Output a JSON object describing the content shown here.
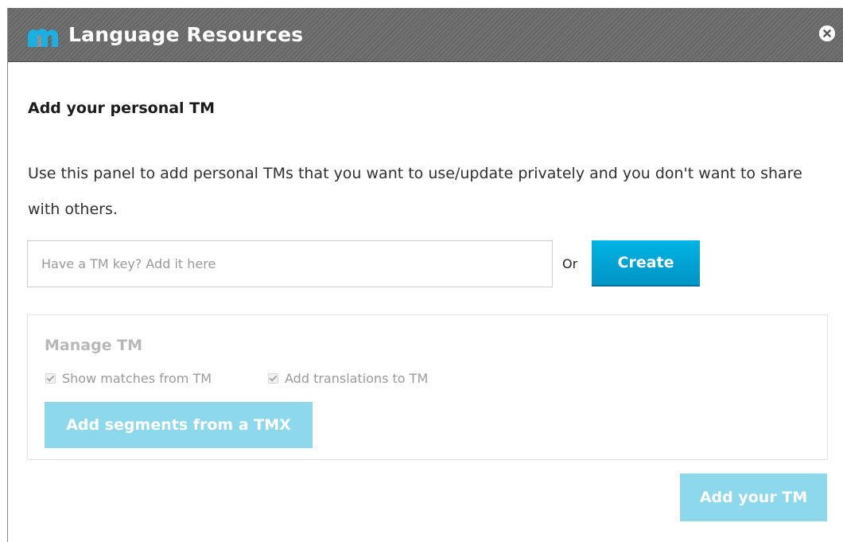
{
  "dialog": {
    "title": "Language Resources",
    "logo_icon": "matecat-logo-icon",
    "close_icon": "close-circle-icon"
  },
  "content": {
    "heading": "Add your personal TM",
    "description": "Use this panel to add personal TMs that you want to use/update privately and you don't want to share with others.",
    "key_input": {
      "value": "",
      "placeholder": "Have a TM key? Add it here"
    },
    "or_label": "Or",
    "create_label": "Create"
  },
  "manage": {
    "title": "Manage TM",
    "options": [
      {
        "label": "Show matches from TM",
        "checked": true,
        "disabled": true
      },
      {
        "label": "Add translations to TM",
        "checked": true,
        "disabled": true
      }
    ],
    "tmx_label": "Add segments from a TMX"
  },
  "footer": {
    "add_tm_label": "Add your TM"
  },
  "colors": {
    "titlebar": "#6b6b6b",
    "accent": "#00a5d6",
    "accent_disabled": "#8ed8ec",
    "logo": "#19b0e3"
  }
}
